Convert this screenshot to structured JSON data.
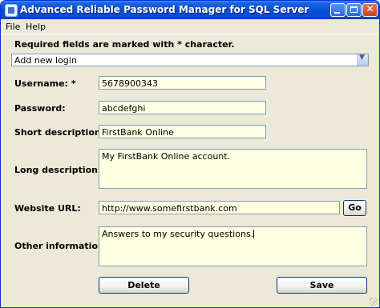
{
  "window": {
    "title": "Advanced Reliable Password Manager for SQL Server"
  },
  "menu": {
    "items": [
      "File",
      "Help"
    ]
  },
  "form": {
    "required_note": "Required fields are marked with * character.",
    "login_select": {
      "value": "Add new login"
    },
    "username": {
      "label": "Username: *",
      "value": "5678900343"
    },
    "password": {
      "label": "Password:",
      "value": "abcdefghi"
    },
    "short_description": {
      "label": "Short description: *",
      "value": "FirstBank Online"
    },
    "long_description": {
      "label": "Long description:",
      "value": "My FirstBank Online account."
    },
    "website_url": {
      "label": "Website URL:",
      "value": "http://www.somefirstbank.com",
      "go_label": "Go"
    },
    "other_information": {
      "label": "Other information:",
      "value": "Answers to my security questions."
    }
  },
  "actions": {
    "delete_label": "Delete",
    "save_label": "Save"
  }
}
